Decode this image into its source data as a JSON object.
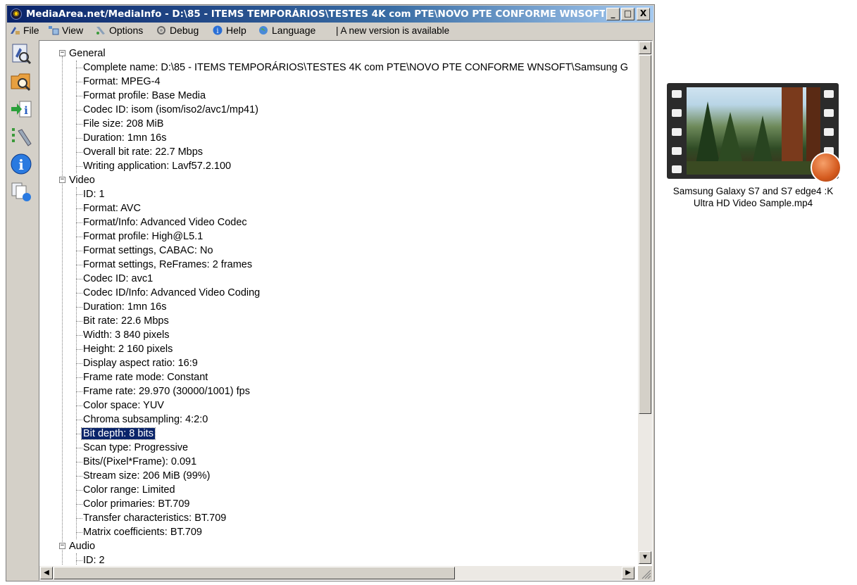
{
  "window": {
    "title": "MediaArea.net/MediaInfo - D:\\85 - ITEMS TEMPORÁRIOS\\TESTES 4K com PTE\\NOVO PTE CONFORME WNSOFT\\S..."
  },
  "title_buttons": {
    "minimize": "_",
    "maximize": "□",
    "close": "X"
  },
  "menu": {
    "items": [
      {
        "label": "File",
        "icon": "file-icon"
      },
      {
        "label": "View",
        "icon": "view-icon"
      },
      {
        "label": "Options",
        "icon": "options-icon"
      },
      {
        "label": "Debug",
        "icon": "debug-icon"
      },
      {
        "label": "Help",
        "icon": "help-icon"
      },
      {
        "label": "Language",
        "icon": "language-icon"
      }
    ],
    "notice": "| A new version is available"
  },
  "sidebar": {
    "buttons": [
      "open-file-icon",
      "open-folder-icon",
      "export-icon",
      "preferences-icon",
      "about-icon",
      "check-update-icon"
    ]
  },
  "tree": {
    "sections": [
      {
        "name": "General",
        "items": [
          "Complete name: D:\\85 - ITEMS TEMPORÁRIOS\\TESTES 4K com PTE\\NOVO PTE CONFORME WNSOFT\\Samsung G",
          "Format: MPEG-4",
          "Format profile: Base Media",
          "Codec ID: isom (isom/iso2/avc1/mp41)",
          "File size: 208 MiB",
          "Duration: 1mn 16s",
          "Overall bit rate: 22.7 Mbps",
          "Writing application: Lavf57.2.100"
        ]
      },
      {
        "name": "Video",
        "items": [
          "ID: 1",
          "Format: AVC",
          "Format/Info: Advanced Video Codec",
          "Format profile: High@L5.1",
          "Format settings, CABAC: No",
          "Format settings, ReFrames: 2 frames",
          "Codec ID: avc1",
          "Codec ID/Info: Advanced Video Coding",
          "Duration: 1mn 16s",
          "Bit rate: 22.6 Mbps",
          "Width: 3 840 pixels",
          "Height: 2 160 pixels",
          "Display aspect ratio: 16:9",
          "Frame rate mode: Constant",
          "Frame rate: 29.970 (30000/1001) fps",
          "Color space: YUV",
          "Chroma subsampling: 4:2:0",
          "Bit depth: 8 bits",
          "Scan type: Progressive",
          "Bits/(Pixel*Frame): 0.091",
          "Stream size: 206 MiB (99%)",
          "Color range: Limited",
          "Color primaries: BT.709",
          "Transfer characteristics: BT.709",
          "Matrix coefficients: BT.709"
        ]
      },
      {
        "name": "Audio",
        "items": [
          "ID: 2"
        ]
      }
    ],
    "selected": "Bit depth: 8 bits",
    "vertical_scroll_fraction": 0.0,
    "horizontal_scroll_fraction": 0.0
  },
  "desktop_file": {
    "icon": "video-file-thumbnail-icon",
    "line1": "Samsung Galaxy S7 and S7 edge4 :K",
    "line2": "Ultra HD Video Sample.mp4"
  }
}
